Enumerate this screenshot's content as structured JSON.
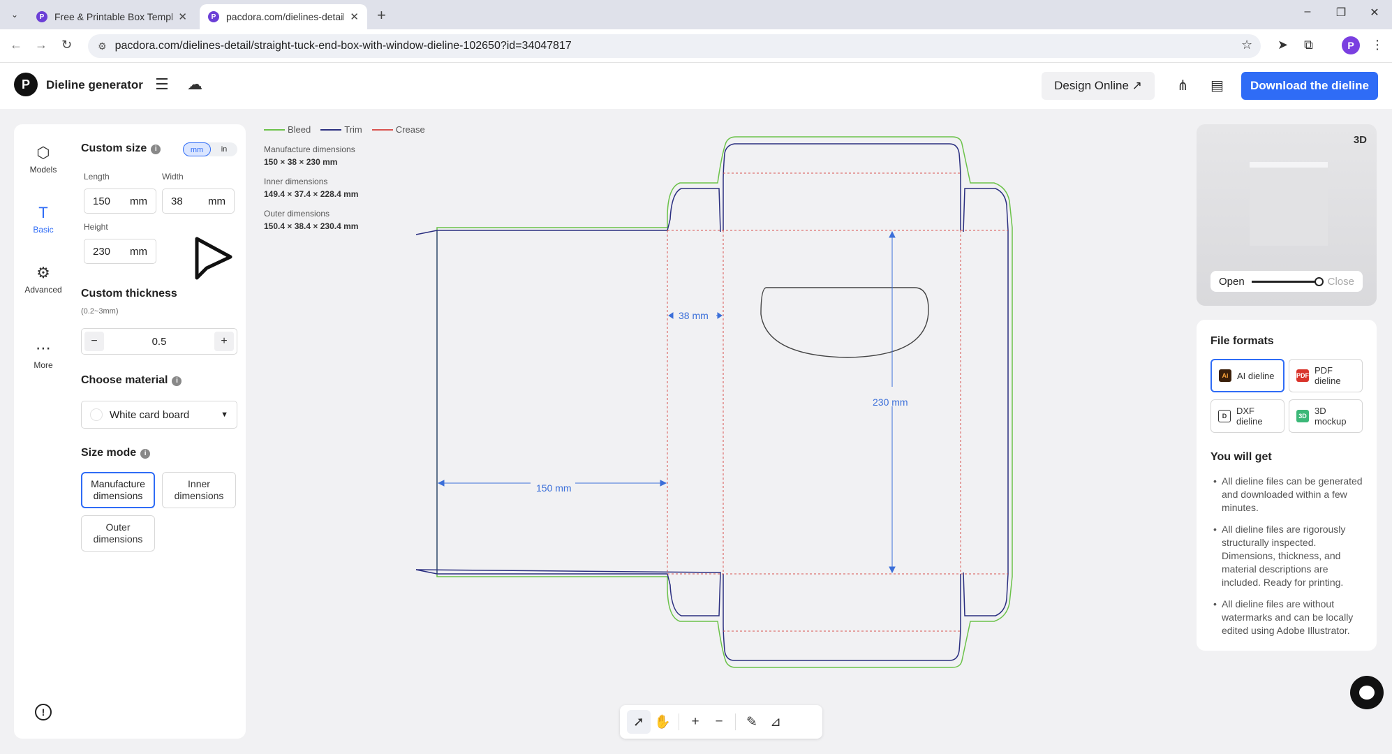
{
  "browser": {
    "tabs": [
      {
        "title": "Free & Printable Box Templat",
        "active": false
      },
      {
        "title": "pacdora.com/dielines-detail/",
        "active": true
      }
    ],
    "url": "pacdora.com/dielines-detail/straight-tuck-end-box-with-window-dieline-102650?id=34047817"
  },
  "header": {
    "app_title": "Dieline generator",
    "design_online": "Design Online ↗",
    "download": "Download the dieline"
  },
  "rail": {
    "items": [
      {
        "label": "Models",
        "icon": "cube-icon"
      },
      {
        "label": "Basic",
        "icon": "basic-icon",
        "active": true
      },
      {
        "label": "Advanced",
        "icon": "advanced-icon"
      },
      {
        "label": "More",
        "icon": "more-icon"
      }
    ]
  },
  "settings": {
    "custom_size_title": "Custom size",
    "unit_mm": "mm",
    "unit_in": "in",
    "length_label": "Length",
    "length_value": "150",
    "width_label": "Width",
    "width_value": "38",
    "height_label": "Height",
    "height_value": "230",
    "unit_suffix": "mm",
    "thickness_title": "Custom thickness",
    "thickness_hint": "(0.2~3mm)",
    "thickness_value": "0.5",
    "material_title": "Choose material",
    "material_value": "White card board",
    "size_mode_title": "Size mode",
    "mode_manufacture": "Manufacture dimensions",
    "mode_inner": "Inner dimensions",
    "mode_outer": "Outer dimensions"
  },
  "legend": {
    "bleed": "Bleed",
    "trim": "Trim",
    "crease": "Crease",
    "colors": {
      "bleed": "#6cc24a",
      "trim": "#2b2f80",
      "crease": "#d9534f"
    }
  },
  "dimensions": {
    "manufacture_label": "Manufacture dimensions",
    "manufacture_value": "150 × 38 × 230 mm",
    "inner_label": "Inner dimensions",
    "inner_value": "149.4 × 37.4 × 228.4 mm",
    "outer_label": "Outer dimensions",
    "outer_value": "150.4 × 38.4 × 230.4 mm"
  },
  "dieline_labels": {
    "length": "150 mm",
    "width": "38 mm",
    "height": "230 mm"
  },
  "preview": {
    "badge": "3D",
    "open_label": "Open",
    "close_label": "Close",
    "open_level": 1.0
  },
  "formats": {
    "title": "File formats",
    "items": [
      {
        "label": "AI dieline",
        "icon": "ai-file-icon",
        "color": "#3a1f0a",
        "selected": true
      },
      {
        "label": "PDF dieline",
        "icon": "pdf-file-icon",
        "color": "#d9342b"
      },
      {
        "label": "DXF dieline",
        "icon": "dxf-file-icon",
        "color": "#333333"
      },
      {
        "label": "3D mockup",
        "icon": "mockup-icon",
        "color": "#3cb878"
      }
    ],
    "you_will_get": "You will get",
    "benefits": [
      "All dieline files can be generated and downloaded within a few minutes.",
      "All dieline files are rigorously structurally inspected. Dimensions, thickness, and material descriptions are included. Ready for printing.",
      "All dieline files are without watermarks and can be locally edited using Adobe Illustrator."
    ]
  },
  "accent_color": "#2f6cf6"
}
